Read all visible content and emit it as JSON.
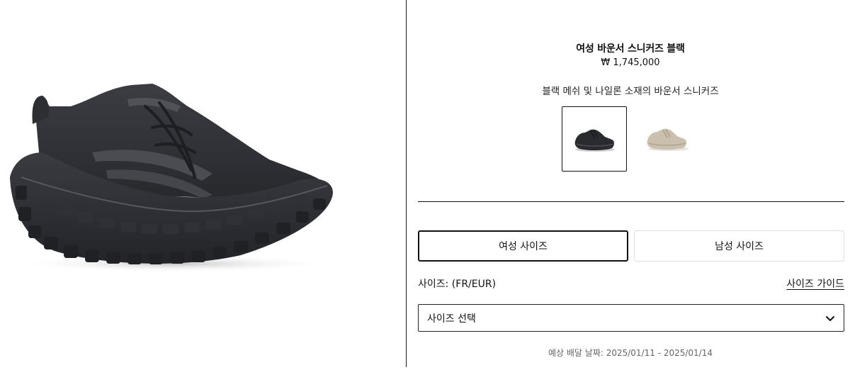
{
  "product": {
    "title": "여성 바운서 스니커즈 블랙",
    "price": "₩ 1,745,000",
    "description": "블랙 메쉬 및 나일론 소재의 바운서 스니커즈",
    "main_image_icon": "black-chunky-sneaker-image"
  },
  "swatches": [
    {
      "color_name": "black",
      "icon": "sneaker-black-thumbnail",
      "selected": true,
      "hex": "#2a2b2e"
    },
    {
      "color_name": "beige",
      "icon": "sneaker-beige-thumbnail",
      "selected": false,
      "hex": "#cbbfae"
    }
  ],
  "size_tabs": [
    {
      "label": "여성 사이즈",
      "active": true
    },
    {
      "label": "남성 사이즈",
      "active": false
    }
  ],
  "size": {
    "label": "사이즈: (FR/EUR)",
    "guide_link": "사이즈 가이드",
    "select_placeholder": "사이즈 선택",
    "chevron_icon": "chevron-down-icon"
  },
  "delivery": "예상 배달 날짜: 2025/01/11 - 2025/01/14",
  "colors": {
    "border_dark": "#111111",
    "border_light": "#dddddd",
    "muted_text": "#666666"
  }
}
